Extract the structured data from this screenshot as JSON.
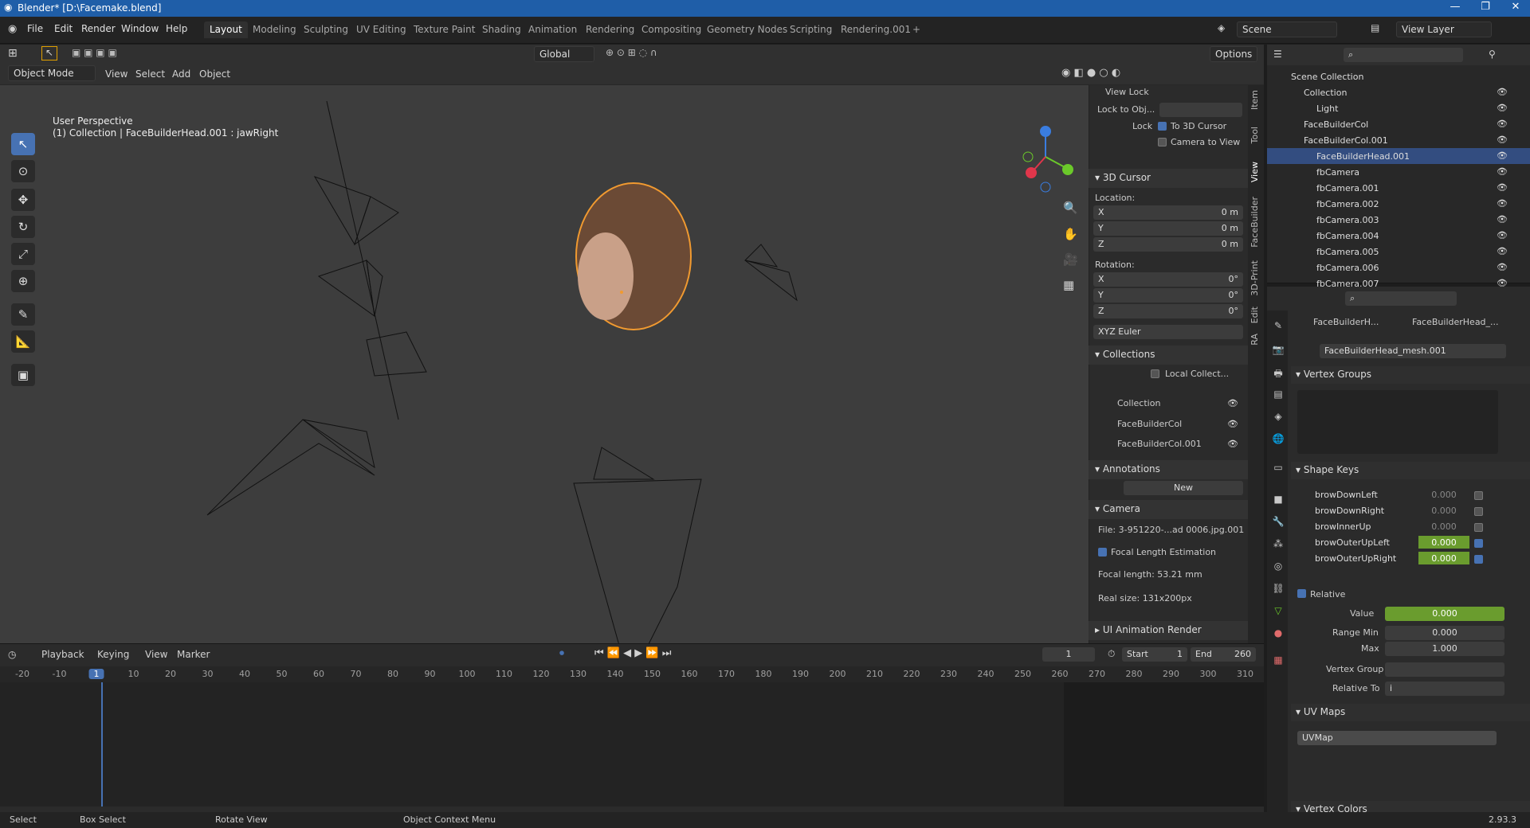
{
  "window": {
    "title": "Blender* [D:\\Facemake.blend]",
    "min": "—",
    "max": "❐",
    "close": "✕"
  },
  "menu": {
    "items": [
      "File",
      "Edit",
      "Render",
      "Window",
      "Help"
    ]
  },
  "workspaces": [
    "Layout",
    "Modeling",
    "Sculpting",
    "UV Editing",
    "Texture Paint",
    "Shading",
    "Animation",
    "Rendering",
    "Compositing",
    "Geometry Nodes",
    "Scripting",
    "Rendering.001",
    "+"
  ],
  "scene": {
    "scene_name": "Scene",
    "view_layer": "View Layer"
  },
  "viewport": {
    "mode": "Object Mode",
    "menus": [
      "View",
      "Select",
      "Add",
      "Object"
    ],
    "orientation": "Global",
    "options": "Options",
    "info_line1": "User Perspective",
    "info_line2": "(1) Collection | FaceBuilderHead.001 : jawRight"
  },
  "npanel": {
    "view_lock": "View Lock",
    "lock_to_obj": "Lock to Obj...",
    "lock": "Lock",
    "to_3d_cursor": "To 3D Cursor",
    "camera_to_view": "Camera to View",
    "cursor_title": "3D Cursor",
    "location": "Location:",
    "rotation": "Rotation:",
    "x": "X",
    "y": "Y",
    "z": "Z",
    "loc_val": "0 m",
    "rot_val": "0°",
    "euler": "XYZ Euler",
    "collections_title": "Collections",
    "local_collect": "Local Collect...",
    "col1": "Collection",
    "col2": "FaceBuilderCol",
    "col3": "FaceBuilderCol.001",
    "annotations_title": "Annotations",
    "new": "New",
    "camera_title": "Camera",
    "file": "File: 3-951220-...ad 0006.jpg.001",
    "focal_est": "Focal Length Estimation",
    "focal_len": "Focal length: 53.21 mm",
    "real_size": "Real size: 131x200px",
    "ui_anim": "UI Animation Render",
    "tabs": [
      "Item",
      "Tool",
      "View",
      "FaceBuilder",
      "3D-Print",
      "Edit",
      "RA"
    ]
  },
  "outliner": {
    "rows": [
      {
        "label": "Scene Collection",
        "indent": 0
      },
      {
        "label": "Collection",
        "indent": 1
      },
      {
        "label": "Light",
        "indent": 2
      },
      {
        "label": "FaceBuilderCol",
        "indent": 1
      },
      {
        "label": "FaceBuilderCol.001",
        "indent": 1
      },
      {
        "label": "FaceBuilderHead.001",
        "indent": 2
      },
      {
        "label": "fbCamera",
        "indent": 2
      },
      {
        "label": "fbCamera.001",
        "indent": 2
      },
      {
        "label": "fbCamera.002",
        "indent": 2
      },
      {
        "label": "fbCamera.003",
        "indent": 2
      },
      {
        "label": "fbCamera.004",
        "indent": 2
      },
      {
        "label": "fbCamera.005",
        "indent": 2
      },
      {
        "label": "fbCamera.006",
        "indent": 2
      },
      {
        "label": "fbCamera.007",
        "indent": 2
      }
    ]
  },
  "properties": {
    "obj": "FaceBuilderH...",
    "mesh_tab": "FaceBuilderHead_...",
    "mesh": "FaceBuilderHead_mesh.001",
    "vertex_groups": "Vertex Groups",
    "shape_keys": "Shape Keys",
    "keys": [
      {
        "name": "browDownLeft",
        "val": "0.000"
      },
      {
        "name": "browDownRight",
        "val": "0.000"
      },
      {
        "name": "browInnerUp",
        "val": "0.000"
      },
      {
        "name": "browOuterUpLeft",
        "val": "0.000"
      },
      {
        "name": "browOuterUpRight",
        "val": "0.000"
      }
    ],
    "relative": "Relative",
    "value_lbl": "Value",
    "value": "0.000",
    "range_min_lbl": "Range Min",
    "range_min": "0.000",
    "max_lbl": "Max",
    "max": "1.000",
    "vgroup_lbl": "Vertex Group",
    "relto_lbl": "Relative To",
    "relto": "i",
    "uv_maps": "UV Maps",
    "uvmap": "UVMap",
    "vertex_colors": "Vertex Colors"
  },
  "timeline": {
    "menus": [
      "Playback",
      "Keying",
      "View",
      "Marker"
    ],
    "current": "1",
    "start_lbl": "Start",
    "start": "1",
    "end_lbl": "End",
    "end": "260",
    "ticks": [
      "-20",
      "-10",
      "1",
      "10",
      "20",
      "30",
      "40",
      "50",
      "60",
      "70",
      "80",
      "90",
      "100",
      "110",
      "120",
      "130",
      "140",
      "150",
      "160",
      "170",
      "180",
      "190",
      "200",
      "210",
      "220",
      "230",
      "240",
      "250",
      "260",
      "270",
      "280",
      "290",
      "300",
      "310"
    ]
  },
  "status": {
    "select": "Select",
    "box": "Box Select",
    "rotate": "Rotate View",
    "ctx": "Object Context Menu",
    "version": "2.93.3"
  }
}
